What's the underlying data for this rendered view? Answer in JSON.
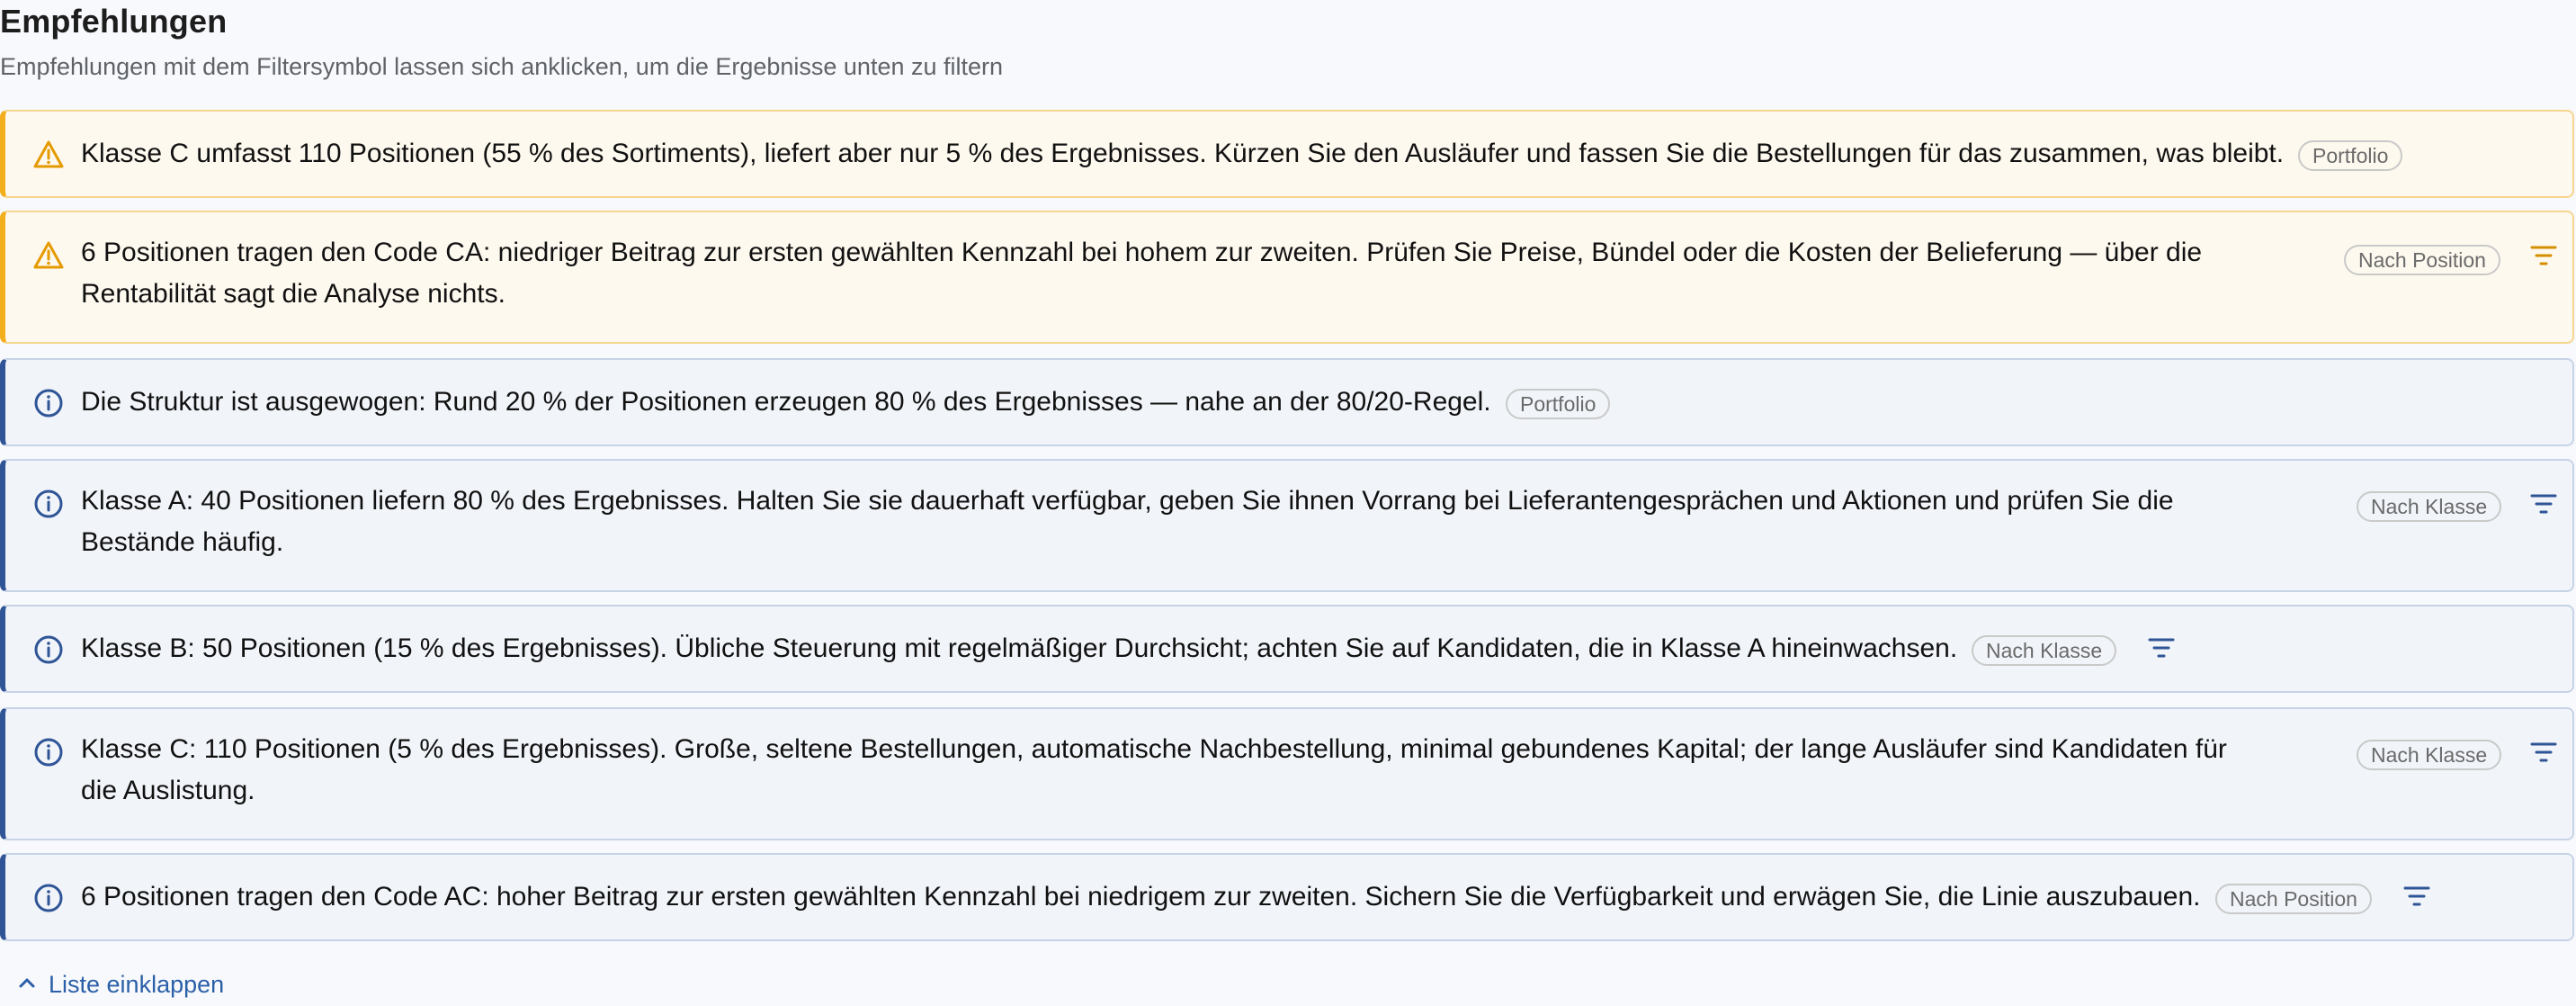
{
  "section": {
    "title": "Empfehlungen",
    "subtitle": "Empfehlungen mit dem Filtersymbol lassen sich anklicken, um die Ergebnisse unten zu filtern"
  },
  "recommendations": [
    {
      "type": "warning",
      "icon": "warning-triangle-icon",
      "text": "Klasse C umfasst 110 Positionen (55 % des Sortiments), liefert aber nur 5 % des Ergebnisses. Kürzen Sie den Ausläufer und fassen Sie die Bestellungen für das zusammen, was bleibt.",
      "badge": "Portfolio",
      "filterable": false
    },
    {
      "type": "warning",
      "icon": "warning-triangle-icon",
      "text_line1": "6 Positionen tragen den Code CA: niedriger Beitrag zur ersten gewählten Kennzahl bei hohem zur zweiten. Prüfen Sie Preise, Bündel oder die Kosten der Belieferung — über die",
      "text_line2": "Rentabilität sagt die Analyse nichts.",
      "badge": "Nach Position",
      "filterable": true
    },
    {
      "type": "info",
      "icon": "info-circle-icon",
      "text": "Die Struktur ist ausgewogen: Rund 20 % der Positionen erzeugen 80 % des Ergebnisses — nahe an der 80/20-Regel.",
      "badge": "Portfolio",
      "filterable": false
    },
    {
      "type": "info",
      "icon": "info-circle-icon",
      "text_line1": "Klasse A: 40 Positionen liefern 80 % des Ergebnisses. Halten Sie sie dauerhaft verfügbar, geben Sie ihnen Vorrang bei Lieferantengesprächen und Aktionen und prüfen Sie die",
      "text_line2": "Bestände häufig.",
      "badge": "Nach Klasse",
      "filterable": true
    },
    {
      "type": "info",
      "icon": "info-circle-icon",
      "text": "Klasse B: 50 Positionen (15 % des Ergebnisses). Übliche Steuerung mit regelmäßiger Durchsicht; achten Sie auf Kandidaten, die in Klasse A hineinwachsen.",
      "badge": "Nach Klasse",
      "filterable": true
    },
    {
      "type": "info",
      "icon": "info-circle-icon",
      "text_line1": "Klasse C: 110 Positionen (5 % des Ergebnisses). Große, seltene Bestellungen, automatische Nachbestellung, minimal gebundenes Kapital; der lange Ausläufer sind Kandidaten für",
      "text_line2": "die Auslistung.",
      "badge": "Nach Klasse",
      "filterable": true
    },
    {
      "type": "info",
      "icon": "info-circle-icon",
      "text": "6 Positionen tragen den Code AC: hoher Beitrag zur ersten gewählten Kennzahl bei niedrigem zur zweiten. Sichern Sie die Verfügbarkeit und erwägen Sie, die Linie auszubauen.",
      "badge": "Nach Position",
      "filterable": true
    }
  ],
  "footer": {
    "collapse_label": "Liste einklappen",
    "collapse_icon": "chevron-up-icon"
  },
  "colors": {
    "warning_accent": "#f3ae1b",
    "info_accent": "#2f5597",
    "link": "#2b5fa8"
  }
}
